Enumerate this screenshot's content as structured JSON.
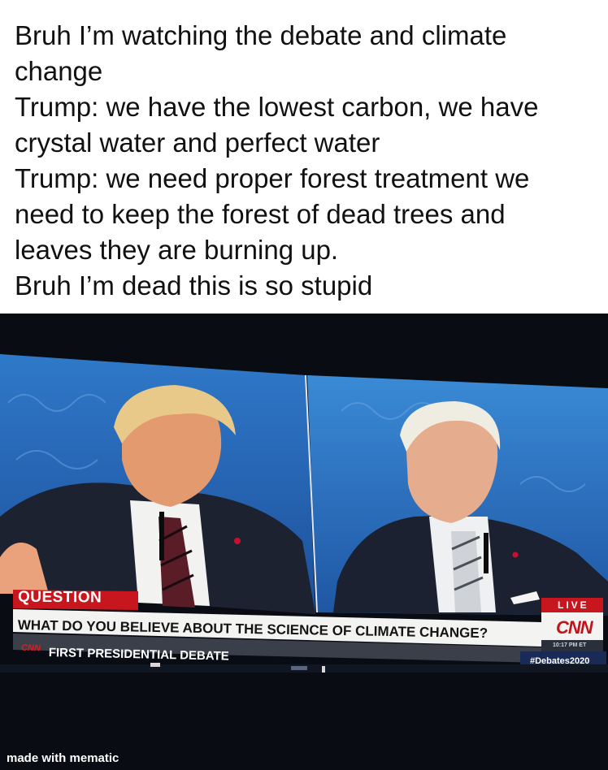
{
  "caption": {
    "lines": [
      "Bruh I’m watching the debate and climate",
      "change",
      "Trump: we have the lowest carbon, we have",
      "crystal water and perfect water",
      "Trump: we need proper forest treatment we",
      "need to keep the forest of dead trees and",
      "leaves they are burning up.",
      "Bruh I’m dead this is so stupid"
    ]
  },
  "broadcast": {
    "question_label": "QUESTION",
    "question_text": "WHAT DO YOU BELIEVE ABOUT THE SCIENCE OF CLIMATE CHANGE?",
    "live_label": "LIVE",
    "network_logo": "CNN",
    "network_logo_small": "CNN",
    "time": "10:17 PM ET",
    "show_title": "FIRST PRESIDENTIAL DEBATE",
    "hashtag": "#Debates2020"
  },
  "watermark": "made with mematic"
}
